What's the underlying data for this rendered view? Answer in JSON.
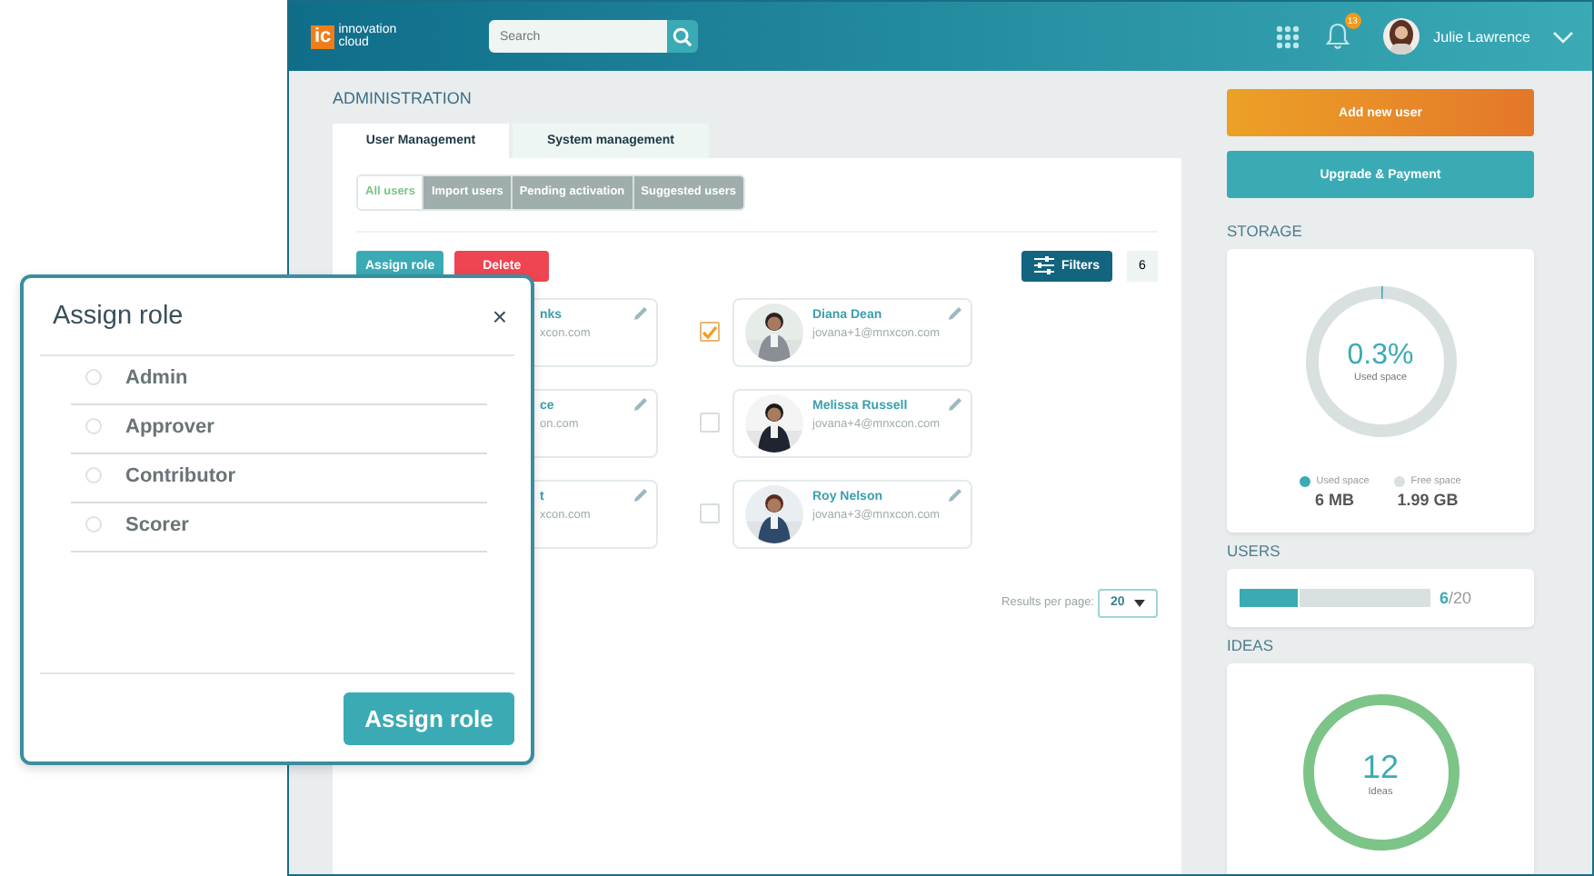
{
  "header": {
    "logo_mark": "ic",
    "logo_lines": [
      "innovation",
      "cloud"
    ],
    "search_placeholder": "Search",
    "badge": "13",
    "user_name": "Julie Lawrence"
  },
  "page_title": "ADMINISTRATION",
  "tabs": [
    {
      "label": "User Management",
      "selected": true
    },
    {
      "label": "System management",
      "selected": false
    }
  ],
  "subtabs": [
    {
      "label": "All users",
      "selected": true
    },
    {
      "label": "Import users",
      "selected": false
    },
    {
      "label": "Pending activation",
      "selected": false
    },
    {
      "label": "Suggested users",
      "selected": false
    }
  ],
  "actions": {
    "assign_role": "Assign role",
    "delete": "Delete",
    "filters": "Filters",
    "count": "6"
  },
  "partial_cards": [
    {
      "name": "nks",
      "email": "xcon.com"
    },
    {
      "name": "ce",
      "email": "on.com"
    },
    {
      "name": "t",
      "email": "xcon.com"
    }
  ],
  "user_cards": [
    {
      "name": "Diana Dean",
      "email": "jovana+1@mnxcon.com",
      "checked": true
    },
    {
      "name": "Melissa Russell",
      "email": "jovana+4@mnxcon.com",
      "checked": false
    },
    {
      "name": "Roy Nelson",
      "email": "jovana+3@mnxcon.com",
      "checked": false
    }
  ],
  "pagination": {
    "label": "Results per page:",
    "value": "20"
  },
  "sidebar": {
    "add_user": "Add new user",
    "upgrade": "Upgrade & Payment",
    "storage": {
      "title": "STORAGE",
      "percent": "0.3%",
      "caption": "Used space",
      "level": 0.003,
      "legend": [
        {
          "label": "Used space",
          "value": "6 MB",
          "color": "#3aabb5"
        },
        {
          "label": "Free space",
          "value": "1.99 GB",
          "color": "#d9e0e0"
        }
      ]
    },
    "users": {
      "title": "USERS",
      "level": 0.3,
      "count": "6",
      "total": "/20"
    },
    "ideas": {
      "title": "IDEAS",
      "count": "12",
      "caption": "Ideas"
    }
  },
  "dialog": {
    "title": "Assign role",
    "close": "×",
    "options": [
      {
        "label": "Admin",
        "selected": false
      },
      {
        "label": "Approver",
        "selected": false
      },
      {
        "label": "Contributor",
        "selected": false
      },
      {
        "label": "Scorer",
        "selected": false
      }
    ],
    "button": "Assign role"
  }
}
